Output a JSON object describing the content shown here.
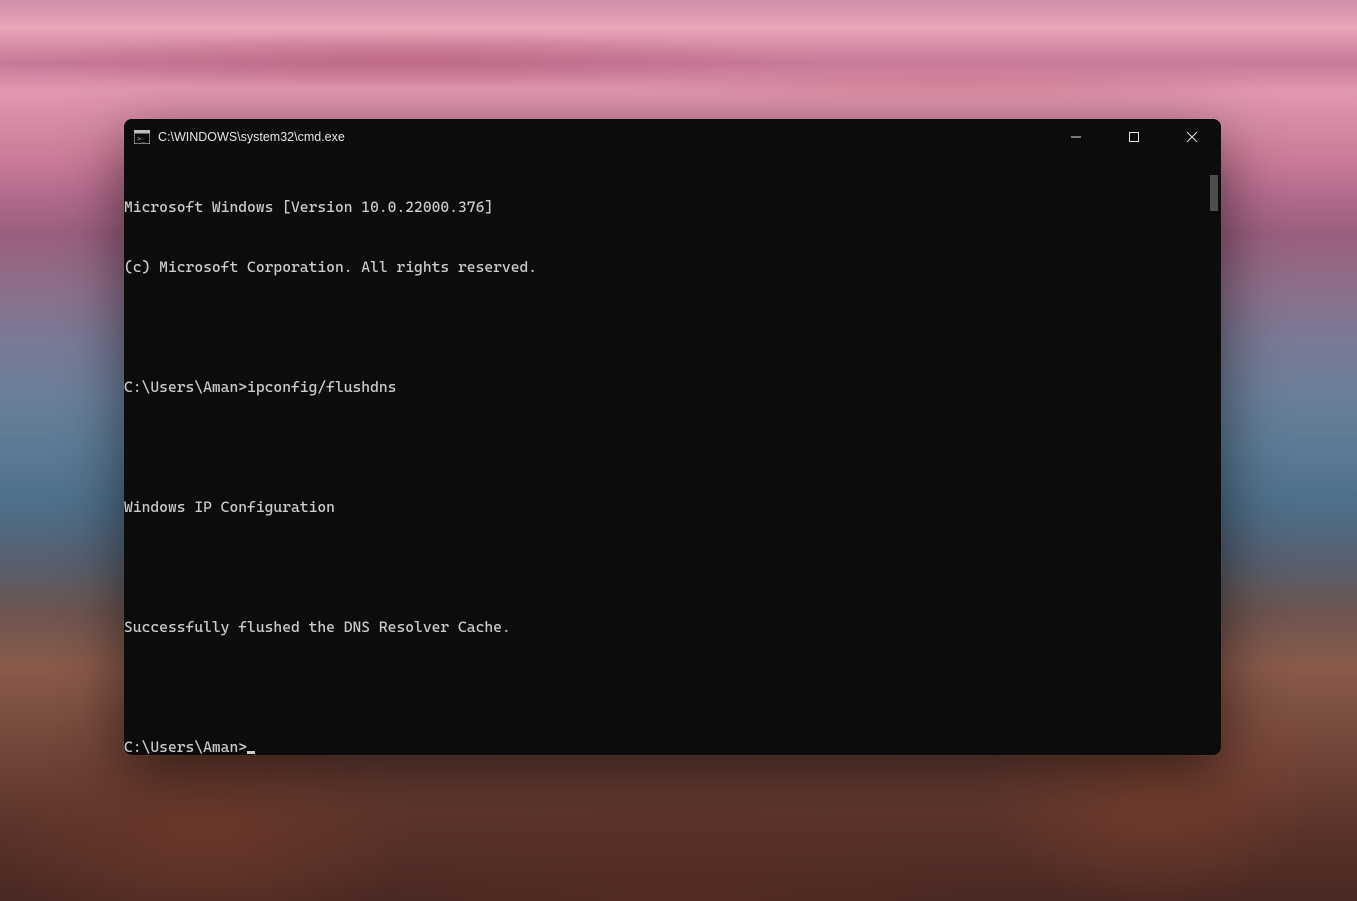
{
  "window": {
    "title": "C:\\WINDOWS\\system32\\cmd.exe"
  },
  "terminal": {
    "lines": [
      "Microsoft Windows [Version 10.0.22000.376]",
      "(c) Microsoft Corporation. All rights reserved.",
      "",
      "C:\\Users\\Aman>ipconfig/flushdns",
      "",
      "Windows IP Configuration",
      "",
      "Successfully flushed the DNS Resolver Cache.",
      ""
    ],
    "prompt": "C:\\Users\\Aman>"
  },
  "controls": {
    "minimize": "minimize",
    "maximize": "maximize",
    "close": "close"
  }
}
